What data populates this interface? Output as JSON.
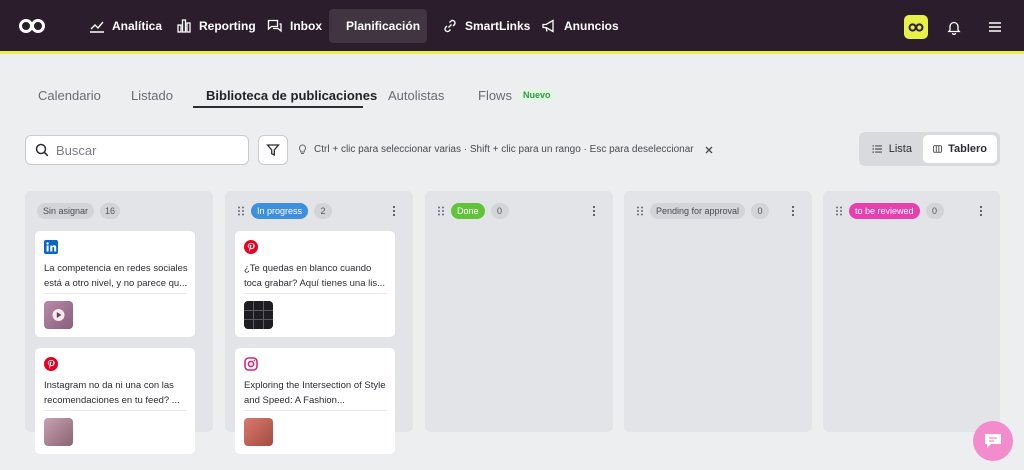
{
  "nav": {
    "items": [
      {
        "label": "Analítica",
        "icon": "chart-line-icon"
      },
      {
        "label": "Reporting",
        "icon": "bar-chart-icon"
      },
      {
        "label": "Inbox",
        "icon": "chat-bubbles-icon"
      },
      {
        "label": "Planificación",
        "icon": "calendar-icon",
        "active": true
      },
      {
        "label": "SmartLinks",
        "icon": "link-icon"
      },
      {
        "label": "Anuncios",
        "icon": "megaphone-icon"
      }
    ],
    "accent": "#e8f04a",
    "background": "#2b1d2b"
  },
  "tabs": [
    {
      "label": "Calendario"
    },
    {
      "label": "Listado"
    },
    {
      "label": "Biblioteca de publicaciones",
      "active": true
    },
    {
      "label": "Autolistas"
    },
    {
      "label": "Flows",
      "badge": "Nuevo"
    }
  ],
  "toolbar": {
    "search_placeholder": "Buscar",
    "hint": "Ctrl + clic para seleccionar varias · Shift + clic para un rango · Esc para deseleccionar",
    "view_list": "Lista",
    "view_board": "Tablero"
  },
  "columns": [
    {
      "label": "Sin asignar",
      "count": "16",
      "pill_bg": "#d2d4d8",
      "pill_fg": "#4a4a52",
      "cards": [
        {
          "network": "linkedin-icon",
          "text": "La competencia en redes sociales está a otro nivel, y no parece qu..."
        },
        {
          "network": "pinterest-icon",
          "text": "Instagram no da ni una con las recomendaciones en tu feed? ..."
        }
      ]
    },
    {
      "label": "In progress",
      "count": "2",
      "pill_bg": "#3d8fe0",
      "pill_fg": "#ffffff",
      "cards": [
        {
          "network": "pinterest-icon",
          "text": "¿Te quedas en blanco cuando toca grabar? Aquí tienes una lis..."
        },
        {
          "network": "instagram-icon",
          "text": "Exploring the Intersection of Style and Speed: A Fashion..."
        }
      ]
    },
    {
      "label": "Done",
      "count": "0",
      "pill_bg": "#5fc43a",
      "pill_fg": "#ffffff",
      "cards": []
    },
    {
      "label": "Pending for approval",
      "count": "0",
      "pill_bg": "#d2d4d8",
      "pill_fg": "#4a4a52",
      "cards": []
    },
    {
      "label": "to be reviewed",
      "count": "0",
      "pill_bg": "#e83fb0",
      "pill_fg": "#ffffff",
      "cards": []
    }
  ]
}
